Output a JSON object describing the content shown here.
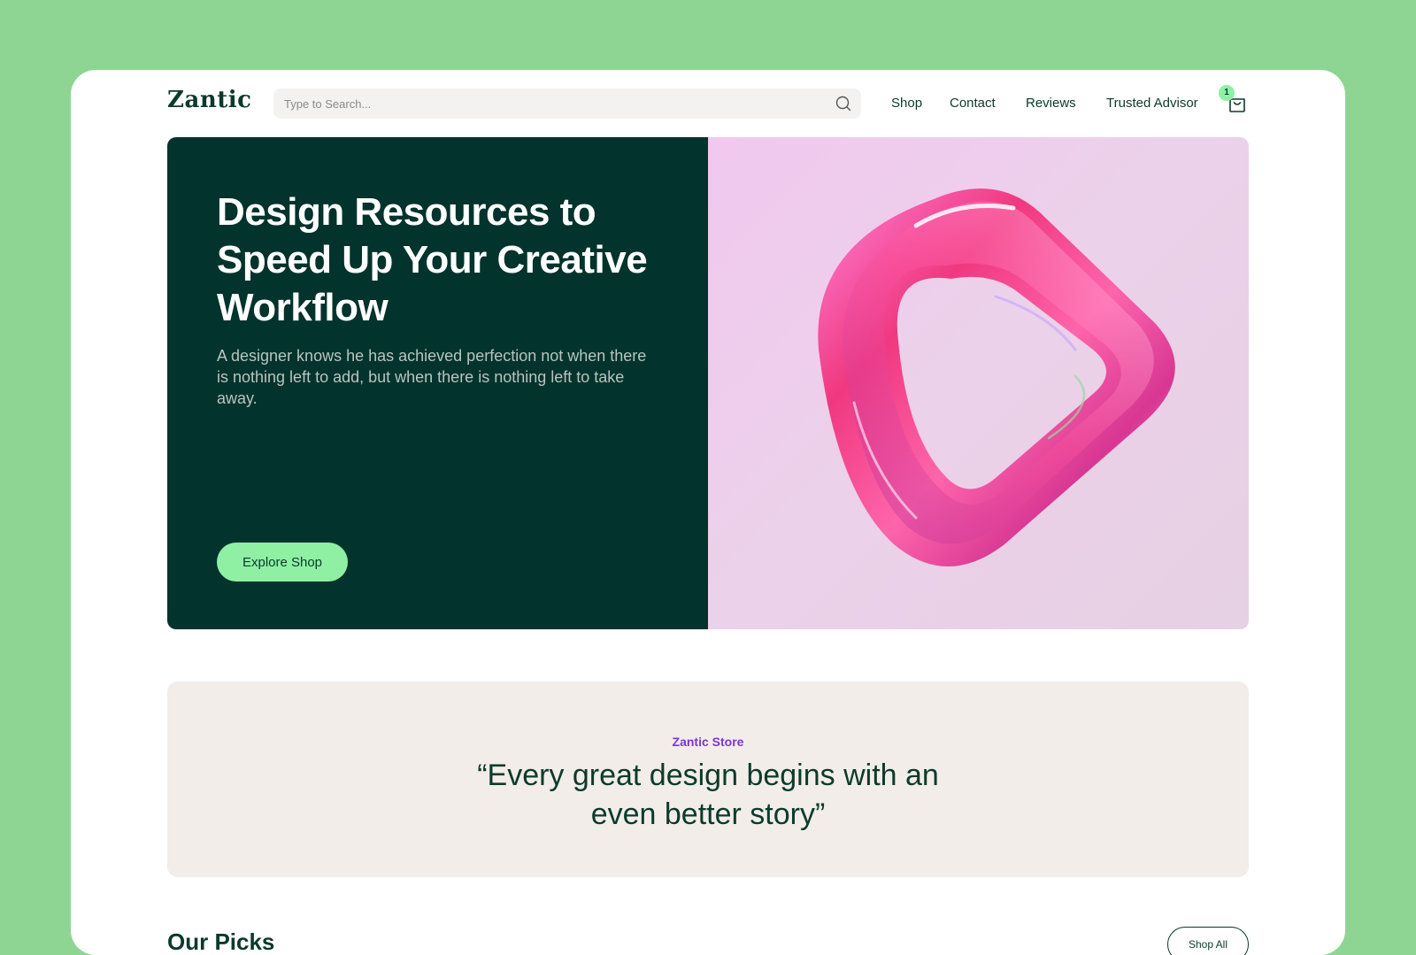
{
  "header": {
    "logo": "Zantic",
    "search_placeholder": "Type to Search...",
    "nav": [
      "Shop",
      "Contact",
      "Reviews",
      "Trusted Advisor"
    ],
    "cart_count": "1"
  },
  "hero": {
    "title": "Design Resources to Speed Up Your Creative Workflow",
    "subtitle": "A designer knows he has achieved perfection not when there is nothing left to add, but when there is nothing left to take away.",
    "cta_label": "Explore Shop"
  },
  "quote": {
    "eyebrow": "Zantic Store",
    "text": "“Every great design begins with an even better story”"
  },
  "picks": {
    "title": "Our Picks",
    "shop_all_label": "Shop All"
  },
  "colors": {
    "page_bg": "#8ed593",
    "hero_dark": "#02332c",
    "accent_green": "#8ff0a4",
    "accent_purple": "#7c35d8",
    "text_dark": "#0c3a2c"
  }
}
